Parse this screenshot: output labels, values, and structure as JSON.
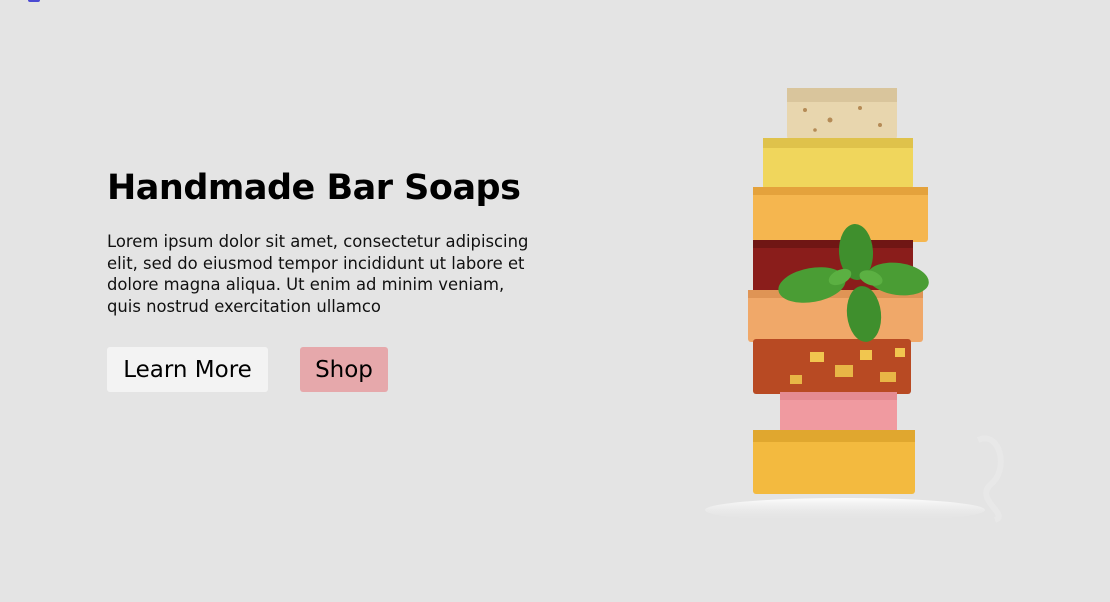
{
  "hero": {
    "title": "Handmade Bar Soaps",
    "description": "Lorem ipsum dolor sit amet, consectetur adipiscing elit, sed do eiusmod tempor incididunt ut labore et dolore magna aliqua. Ut enim ad minim veniam, quis nostrud exercitation ullamco",
    "buttons": {
      "learn_more": "Learn More",
      "shop": "Shop"
    }
  },
  "colors": {
    "background": "#e4e4e4",
    "learn_more_bg": "#f3f3f3",
    "shop_bg": "#e6a8ab"
  }
}
